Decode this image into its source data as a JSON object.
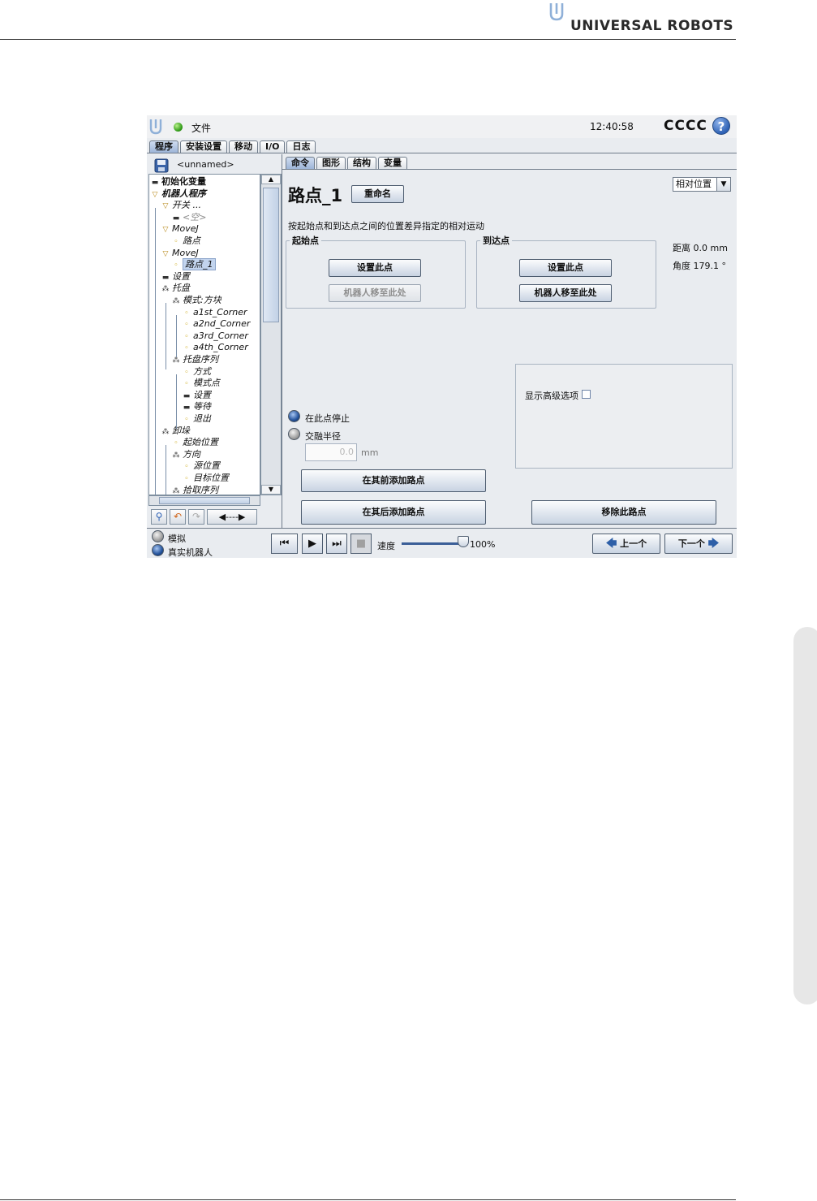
{
  "page": {
    "brand": "UNIVERSAL ROBOTS"
  },
  "topbar": {
    "file_label": "文件",
    "clock": "12:40:58",
    "robot_name": "CCCC",
    "help": "?"
  },
  "main_tabs": [
    "程序",
    "安装设置",
    "移动",
    "I/O",
    "日志"
  ],
  "program": {
    "name": "<unnamed>",
    "tree": [
      {
        "label": "初始化变量",
        "icon": "bar",
        "bold": true
      },
      {
        "label": "机器人程序",
        "icon": "tri",
        "bold": true,
        "italic": true
      },
      {
        "label": "开关 ...",
        "icon": "tri",
        "italic": true
      },
      {
        "label": "<空>",
        "icon": "bar",
        "italic": true,
        "dim": true
      },
      {
        "label": "MoveJ",
        "icon": "tri",
        "italic": true
      },
      {
        "label": "路点",
        "icon": "dot",
        "italic": true
      },
      {
        "label": "MoveJ",
        "icon": "tri",
        "italic": true
      },
      {
        "label": "路点_1",
        "icon": "dot",
        "italic": true,
        "selected": true
      },
      {
        "label": "设置",
        "icon": "bar",
        "italic": true
      },
      {
        "label": "托盘",
        "icon": "pal",
        "italic": true
      },
      {
        "label": "模式:方块",
        "icon": "pal",
        "italic": true
      },
      {
        "label": "a1st_Corner",
        "icon": "dot",
        "italic": true
      },
      {
        "label": "a2nd_Corner",
        "icon": "dot",
        "italic": true
      },
      {
        "label": "a3rd_Corner",
        "icon": "dot",
        "italic": true
      },
      {
        "label": "a4th_Corner",
        "icon": "dot",
        "italic": true
      },
      {
        "label": "托盘序列",
        "icon": "pal",
        "italic": true
      },
      {
        "label": "方式",
        "icon": "dot",
        "italic": true
      },
      {
        "label": "模式点",
        "icon": "dot",
        "italic": true
      },
      {
        "label": "设置",
        "icon": "bar",
        "italic": true
      },
      {
        "label": "等待",
        "icon": "bar",
        "italic": true
      },
      {
        "label": "退出",
        "icon": "dot",
        "italic": true
      },
      {
        "label": "卸垛",
        "icon": "pal",
        "italic": true
      },
      {
        "label": "起始位置",
        "icon": "dot",
        "italic": true
      },
      {
        "label": "方向",
        "icon": "pal",
        "italic": true
      },
      {
        "label": "源位置",
        "icon": "dot",
        "italic": true
      },
      {
        "label": "目标位置",
        "icon": "dot",
        "italic": true
      },
      {
        "label": "拾取序列",
        "icon": "pal",
        "italic": true
      }
    ],
    "tree_depths": [
      0,
      0,
      1,
      2,
      1,
      2,
      1,
      2,
      1,
      1,
      2,
      3,
      3,
      3,
      3,
      2,
      3,
      3,
      3,
      3,
      3,
      1,
      2,
      2,
      3,
      3,
      2
    ],
    "tools_arrows": "◀----▶"
  },
  "sub_tabs": [
    "命令",
    "图形",
    "结构",
    "变量"
  ],
  "waypoint": {
    "title": "路点_1",
    "rename_label": "重命名",
    "mode_select": "相对位置",
    "description": "按起始点和到达点之间的位置差异指定的相对运动",
    "start_group": {
      "legend": "起始点",
      "set_label": "设置此点",
      "move_label": "机器人移至此处"
    },
    "end_group": {
      "legend": "到达点",
      "set_label": "设置此点",
      "move_label": "机器人移至此处"
    },
    "distance": "距离 0.0 mm",
    "angle": "角度 179.1 °",
    "advanced_label": "显示高级选项",
    "stop_label": "在此点停止",
    "blend_label": "交融半径",
    "blend_value": "0.0",
    "blend_unit": "mm",
    "add_before": "在其前添加路点",
    "add_after": "在其后添加路点",
    "remove": "移除此路点"
  },
  "bottom": {
    "sim_label": "模拟",
    "real_label": "真实机器人",
    "speed_label": "速度",
    "speed_value": "100%",
    "speed_fraction": 1.0,
    "prev_label": "上一个",
    "next_label": "下一个"
  },
  "colors": {
    "accent": "#2f62b5",
    "led_green": "#2f9a16",
    "brand_blue": "#8fb0d8"
  }
}
